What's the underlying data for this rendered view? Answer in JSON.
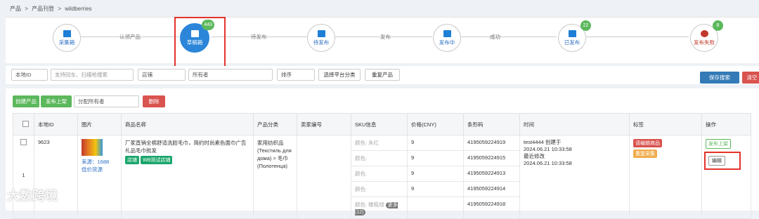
{
  "breadcrumb": {
    "items": [
      "产品",
      ">",
      "产品刊登",
      ">",
      "wildberries"
    ]
  },
  "steps": [
    {
      "label": "采集箱"
    },
    {
      "label": "草稿箱",
      "badge": "443"
    },
    {
      "label": "待发布"
    },
    {
      "label": "发布中"
    },
    {
      "label": "已发布",
      "badge": "22"
    },
    {
      "label": "发布失败",
      "badge": "8"
    }
  ],
  "connectors": [
    "认领产品",
    "待发布",
    "发布",
    "成功"
  ],
  "filters": {
    "local_id": "本地ID",
    "search_placeholder": "支持回车、扫描枪搜索",
    "store": "店铺",
    "owner": "所有者",
    "sort": "排序",
    "choose_platform": "选择平台分类",
    "dup": "重复产品",
    "save_search": "保存搜索",
    "clear": "清空"
  },
  "actions": {
    "create": "创建产品",
    "publish": "发布上架",
    "assign": "分配所有者",
    "delete": "删除"
  },
  "table": {
    "headers": [
      "本地ID",
      "图片",
      "商品名称",
      "产品分类",
      "卖家编号",
      "SKU信息",
      "价格(CNY)",
      "条形码",
      "时间",
      "标签",
      "操作"
    ],
    "row": {
      "id": "9623",
      "row_num": "1",
      "source": "来源：1688",
      "low_price": "低价货源",
      "name": "厂家直销全棉舒适洗脸毛巾，简约时尚素色面巾广告礼品毛巾批发",
      "tag_store": "店铺",
      "tag_wb": "WB测试店铺",
      "category": "家用纺织品 (Текстиль для дома) > 毛巾 (Полотенца)",
      "skus": [
        {
          "label": "颜色: 朱红",
          "price": "9",
          "barcode": "4195059224919"
        },
        {
          "label": "颜色:",
          "price": "9",
          "barcode": "4195059224915"
        },
        {
          "label": "颜色:",
          "price": "9",
          "barcode": "4195059224913"
        },
        {
          "label": "颜色:",
          "price": "9",
          "barcode": "4195059224914"
        },
        {
          "label": "颜色: 橄榄绿",
          "price": "",
          "barcode": "4195059224918"
        }
      ],
      "more": "更多 (12)",
      "time_created": "test4444 创建于",
      "time_created_date": "2024.06.21 10:33:58",
      "time_mod": "最近修改",
      "time_mod_date": "2024.06.21 10:33:58",
      "label_edit": "请编辑商品",
      "label_dup": "重复采集",
      "publish_link": "发布上架",
      "edit": "编辑"
    }
  },
  "watermark": "大数跨境",
  "colors": {
    "accent": "#2b86d9",
    "green": "#5cb85c",
    "red": "#d9534f",
    "orange": "#f0ad4e",
    "highlight": "#e3332b"
  }
}
